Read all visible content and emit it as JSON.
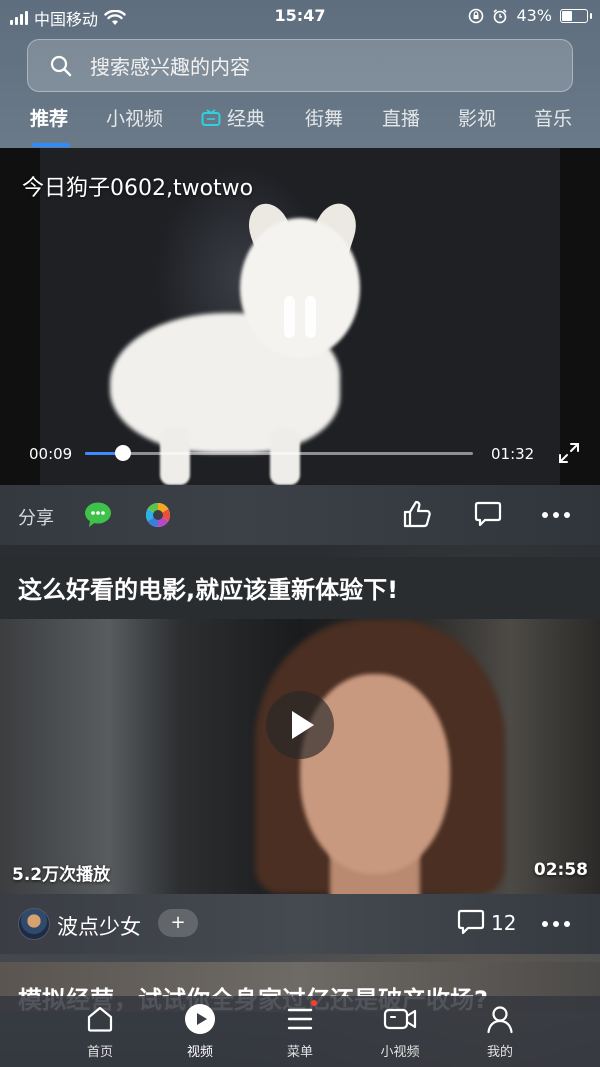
{
  "status_bar": {
    "carrier": "中国移动",
    "time": "15:47",
    "battery": "43%",
    "battery_level": 0.43
  },
  "search": {
    "placeholder": "搜索感兴趣的内容"
  },
  "tabs": [
    {
      "label": "推荐",
      "active": true
    },
    {
      "label": "小视频"
    },
    {
      "label": "经典",
      "icon": "tv-icon"
    },
    {
      "label": "街舞"
    },
    {
      "label": "直播"
    },
    {
      "label": "影视"
    },
    {
      "label": "音乐"
    }
  ],
  "video1": {
    "title": "今日狗子0602,twotwo",
    "current_time": "00:09",
    "total_time": "01:32",
    "progress_fraction": 0.098,
    "share_label": "分享"
  },
  "video2": {
    "title": "这么好看的电影,就应该重新体验下!",
    "views": "5.2万次播放",
    "duration": "02:58",
    "author": "波点少女",
    "follow_label": "+",
    "comment_count": "12"
  },
  "next_card": {
    "title": "模拟经营，试试你全身家过亿还是破产收场?"
  },
  "bottom_nav": [
    {
      "label": "首页",
      "icon": "home-icon"
    },
    {
      "label": "视频",
      "icon": "video-play-icon",
      "active": true
    },
    {
      "label": "菜单",
      "icon": "menu-icon",
      "badge": true
    },
    {
      "label": "小视频",
      "icon": "camera-icon"
    },
    {
      "label": "我的",
      "icon": "profile-icon"
    }
  ],
  "colors": {
    "accent": "#2f8cff",
    "wechat_green": "#3fc24a",
    "badge_red": "#ff3b30"
  }
}
